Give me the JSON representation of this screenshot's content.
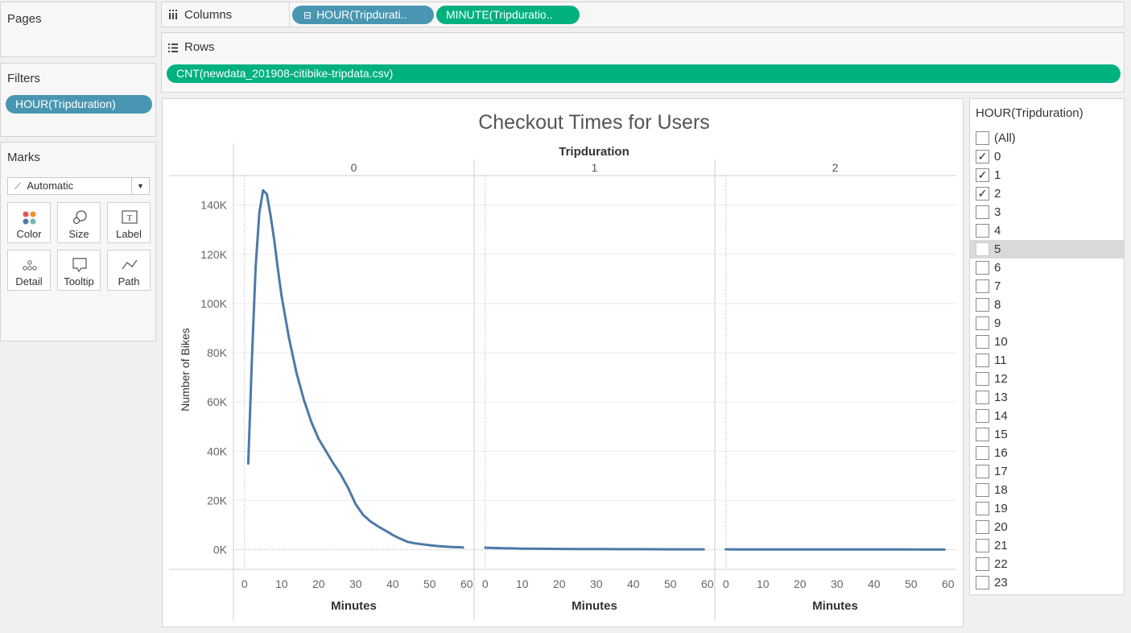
{
  "pages": {
    "title": "Pages"
  },
  "filters": {
    "title": "Filters",
    "pill": "HOUR(Tripduration)"
  },
  "marks": {
    "title": "Marks",
    "type": "Automatic",
    "buttons": [
      {
        "label": "Color",
        "icon": "color-dots-icon"
      },
      {
        "label": "Size",
        "icon": "size-icon"
      },
      {
        "label": "Label",
        "icon": "label-icon"
      },
      {
        "label": "Detail",
        "icon": "detail-icon"
      },
      {
        "label": "Tooltip",
        "icon": "tooltip-icon"
      },
      {
        "label": "Path",
        "icon": "path-icon"
      }
    ]
  },
  "columns": {
    "label": "Columns",
    "pills": [
      "HOUR(Tripdurati..",
      "MINUTE(Tripduratio.."
    ]
  },
  "rows": {
    "label": "Rows",
    "pill": "CNT(newdata_201908-citibike-tripdata.csv)"
  },
  "colors": {
    "blue_pill": "#4996b2",
    "green_pill": "#00b180",
    "line": "#4e79a7"
  },
  "legend": {
    "title": "HOUR(Tripduration)",
    "items": [
      {
        "label": "(All)",
        "checked": false
      },
      {
        "label": "0",
        "checked": true
      },
      {
        "label": "1",
        "checked": true
      },
      {
        "label": "2",
        "checked": true
      },
      {
        "label": "3",
        "checked": false
      },
      {
        "label": "4",
        "checked": false
      },
      {
        "label": "5",
        "checked": false,
        "hover": true
      },
      {
        "label": "6",
        "checked": false
      },
      {
        "label": "7",
        "checked": false
      },
      {
        "label": "8",
        "checked": false
      },
      {
        "label": "9",
        "checked": false
      },
      {
        "label": "10",
        "checked": false
      },
      {
        "label": "11",
        "checked": false
      },
      {
        "label": "12",
        "checked": false
      },
      {
        "label": "13",
        "checked": false
      },
      {
        "label": "14",
        "checked": false
      },
      {
        "label": "15",
        "checked": false
      },
      {
        "label": "16",
        "checked": false
      },
      {
        "label": "17",
        "checked": false
      },
      {
        "label": "18",
        "checked": false
      },
      {
        "label": "19",
        "checked": false
      },
      {
        "label": "20",
        "checked": false
      },
      {
        "label": "21",
        "checked": false
      },
      {
        "label": "22",
        "checked": false
      },
      {
        "label": "23",
        "checked": false
      }
    ]
  },
  "chart_data": {
    "type": "line",
    "title": "Checkout Times for Users",
    "column_header": "Tripduration",
    "xlabel": "Minutes",
    "ylabel": "Number of Bikes",
    "xlim": [
      -3,
      62
    ],
    "ylim": [
      -8000,
      152000
    ],
    "x_ticks": [
      0,
      10,
      20,
      30,
      40,
      50,
      60
    ],
    "y_ticks": [
      0,
      20000,
      40000,
      60000,
      80000,
      100000,
      120000,
      140000
    ],
    "y_tick_labels": [
      "0K",
      "20K",
      "40K",
      "60K",
      "80K",
      "100K",
      "120K",
      "140K"
    ],
    "grid": true,
    "panels": [
      {
        "name": "0",
        "x": [
          1,
          2,
          3,
          4,
          5,
          6,
          7,
          8,
          9,
          10,
          12,
          14,
          16,
          18,
          20,
          22,
          24,
          26,
          28,
          30,
          32,
          34,
          36,
          38,
          40,
          42,
          44,
          46,
          48,
          50,
          52,
          54,
          56,
          58,
          59
        ],
        "y": [
          35000,
          78000,
          115000,
          137000,
          146000,
          144500,
          136000,
          126000,
          114000,
          103000,
          86000,
          72000,
          61000,
          52000,
          45000,
          40000,
          35000,
          30500,
          25000,
          18500,
          14200,
          11500,
          9500,
          7800,
          6000,
          4500,
          3200,
          2600,
          2200,
          1800,
          1500,
          1300,
          1100,
          1000,
          900
        ]
      },
      {
        "name": "1",
        "x": [
          0,
          5,
          10,
          15,
          20,
          25,
          30,
          35,
          40,
          45,
          50,
          55,
          59
        ],
        "y": [
          800,
          600,
          450,
          380,
          320,
          280,
          250,
          220,
          200,
          180,
          160,
          150,
          140
        ]
      },
      {
        "name": "2",
        "x": [
          0,
          5,
          10,
          15,
          20,
          25,
          30,
          35,
          40,
          45,
          50,
          55,
          59
        ],
        "y": [
          150,
          130,
          120,
          110,
          100,
          95,
          90,
          85,
          80,
          75,
          70,
          65,
          60
        ]
      }
    ]
  }
}
